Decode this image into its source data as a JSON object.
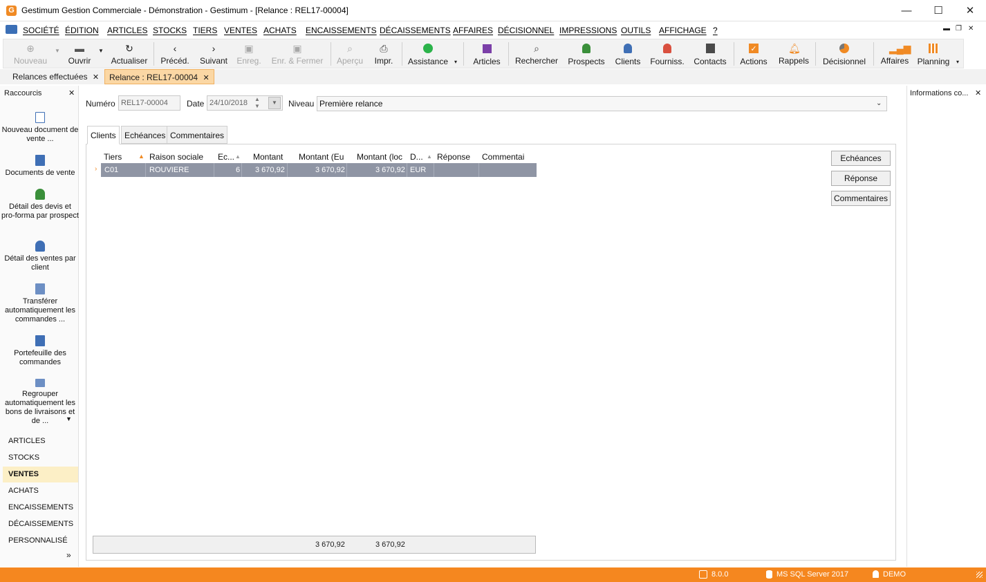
{
  "window": {
    "title": "Gestimum Gestion Commerciale - Démonstration - Gestimum - [Relance : REL17-00004]",
    "logo_letter": "G",
    "controls": {
      "minimize": "—",
      "maximize": "☐",
      "close": "✕"
    }
  },
  "menu": {
    "items": [
      "SOCIÉTÉ",
      "ÉDITION",
      "ARTICLES",
      "STOCKS",
      "TIERS",
      "VENTES",
      "ACHATS",
      "ENCAISSEMENTS",
      "DÉCAISSEMENTS",
      "AFFAIRES",
      "DÉCISIONNEL",
      "IMPRESSIONS",
      "OUTILS",
      "AFFICHAGE",
      "?"
    ],
    "mdi_controls": {
      "minimize": "▬",
      "restore": "❐",
      "close": "✕"
    }
  },
  "toolbar": {
    "nouveau": "Nouveau",
    "ouvrir": "Ouvrir",
    "actualiser": "Actualiser",
    "preced": "Précéd.",
    "suivant": "Suivant",
    "enreg": "Enreg.",
    "enr_fermer": "Enr. & Fermer",
    "apercu": "Aperçu",
    "impr": "Impr.",
    "assistance": "Assistance",
    "articles": "Articles",
    "rechercher": "Rechercher",
    "prospects": "Prospects",
    "clients": "Clients",
    "fourniss": "Fourniss.",
    "contacts": "Contacts",
    "actions": "Actions",
    "rappels": "Rappels",
    "decisionnel": "Décisionnel",
    "affaires": "Affaires",
    "planning": "Planning"
  },
  "doc_tabs": [
    {
      "label": "Relances effectuées",
      "active": false
    },
    {
      "label": "Relance : REL17-00004",
      "active": true
    }
  ],
  "left_panel": {
    "title": "Raccourcis",
    "shortcuts": [
      "Nouveau document de vente ...",
      "Documents de vente",
      "Détail des devis et pro-forma par prospect",
      "Détail des ventes par client",
      "Transférer automatiquement les commandes ...",
      "Portefeuille des commandes",
      "Regrouper automatiquement les bons de livraisons et de ..."
    ],
    "sections": [
      "ARTICLES",
      "STOCKS",
      "VENTES",
      "ACHATS",
      "ENCAISSEMENTS",
      "DÉCAISSEMENTS",
      "PERSONNALISÉ"
    ],
    "active_section": "VENTES",
    "more": "»"
  },
  "right_panel": {
    "title": "Informations co..."
  },
  "form": {
    "numero_label": "Numéro",
    "numero_value": "REL17-00004",
    "date_label": "Date",
    "date_value": "24/10/2018",
    "niveau_label": "Niveau",
    "niveau_value": "Première relance"
  },
  "tabs": [
    "Clients",
    "Echéances",
    "Commentaires"
  ],
  "grid": {
    "columns": [
      "Tiers",
      "Raison sociale",
      "Ec...",
      "Montant",
      "Montant (Eu",
      "Montant (loc",
      "D...",
      "Réponse",
      "Commentai"
    ],
    "rows": [
      [
        "C01",
        "ROUVIERE",
        "6",
        "3 670,92",
        "3 670,92",
        "3 670,92",
        "EUR",
        "",
        ""
      ]
    ],
    "footer": {
      "montant_eu": "3 670,92",
      "montant_loc": "3 670,92"
    }
  },
  "side_buttons": [
    "Echéances",
    "Réponse",
    "Commentaires"
  ],
  "status": {
    "version": "8.0.0",
    "server": "MS SQL Server 2017",
    "user": "DEMO"
  },
  "colors": {
    "accent": "#f5871f",
    "selected_row": "#8f95a4",
    "active_tab": "#fbd7a4",
    "active_section": "#fcefc6"
  }
}
